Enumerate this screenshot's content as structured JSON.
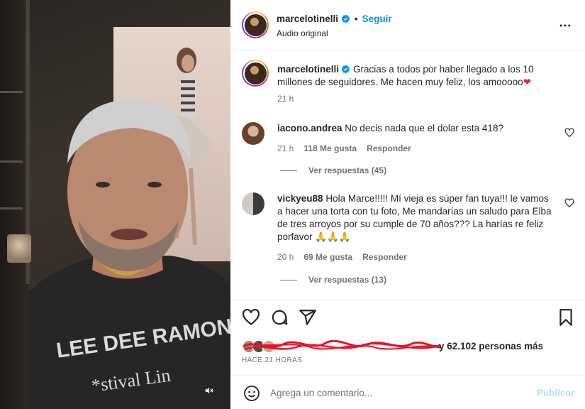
{
  "post": {
    "username": "marcelotinelli",
    "follow_label": "Seguir",
    "audio_label": "Audio original",
    "caption": "Gracias a todos por haber llegado a los 10 millones de seguidores. Me hacen muy feliz, los amooooo",
    "caption_emoji": "❤",
    "caption_time": "21 h"
  },
  "comments": [
    {
      "username": "iacono.andrea",
      "text": "No decis nada que el dolar esta 418?",
      "time": "21 h",
      "likes": "118 Me gusta",
      "reply_label": "Responder",
      "view_replies": "Ver respuestas (45)"
    },
    {
      "username": "vickyeu88",
      "text": "Hola Marce!!!!! Mí vieja es súper fan tuya!!! le vamos a hacer una torta con tu foto, Me mandarías un saludo para Elba de tres arroyos por su cumple de 70 años??? La harías re feliz porfavor 🙏🙏🙏",
      "time": "20 h",
      "likes": "69 Me gusta",
      "reply_label": "Responder",
      "view_replies": "Ver respuestas (13)"
    }
  ],
  "likes_summary": {
    "suffix": "y 62.102 personas más"
  },
  "time_ago": "HACE 21 HORAS",
  "add_comment": {
    "placeholder": "Agrega un comentario...",
    "publish_label": "Publicar"
  },
  "colors": {
    "link": "#0095f6",
    "verified": "#0095f6",
    "publish_disabled": "#b2dffc",
    "secondary_text": "#737373",
    "scribble": "#e8132a"
  },
  "icons": [
    "verified-badge-icon",
    "more-options-icon",
    "heart-icon",
    "comment-icon",
    "share-icon",
    "bookmark-icon",
    "emoji-icon",
    "muted-speaker-icon"
  ]
}
